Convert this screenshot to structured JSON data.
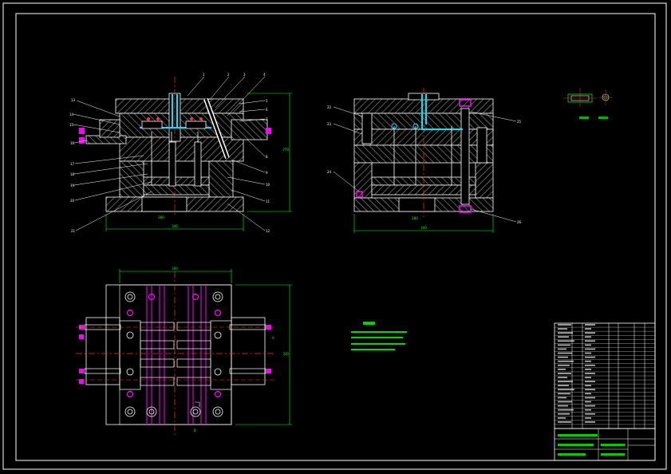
{
  "drawing": {
    "background": "#000000",
    "line_color": "#ffffff",
    "dimension_color": "#00ff00",
    "centerline_color": "#ff3030",
    "cooling_color": "#00e5ff",
    "pin_color": "#ff00ff",
    "hatch_color": "#b8b8b8"
  },
  "section_a": {
    "dim_width": "300",
    "dim_height": "270",
    "dim_inner": "280",
    "callouts_left": [
      "13",
      "14",
      "15",
      "16",
      "17",
      "18",
      "19",
      "20",
      "21"
    ],
    "callouts_top": [
      "1",
      "2",
      "3",
      "4"
    ],
    "callouts_right": [
      "5",
      "6",
      "7",
      "8",
      "9",
      "10",
      "11",
      "12"
    ]
  },
  "section_b": {
    "dim_width": "300",
    "dim_inner": "280",
    "callouts_left": [
      "22",
      "23",
      "24"
    ],
    "callouts_right": [
      "25",
      "26"
    ]
  },
  "plan_view": {
    "dim_top": "300",
    "dim_right": "330",
    "section_mark_left": "A",
    "section_mark_right": "A",
    "section_mark_bottom": "B"
  },
  "part_detail": {
    "caption_left": "",
    "caption_right": ""
  },
  "notes": {
    "title": "",
    "lines": [
      "",
      "",
      "",
      ""
    ]
  },
  "title_block": {
    "rows": 26
  }
}
